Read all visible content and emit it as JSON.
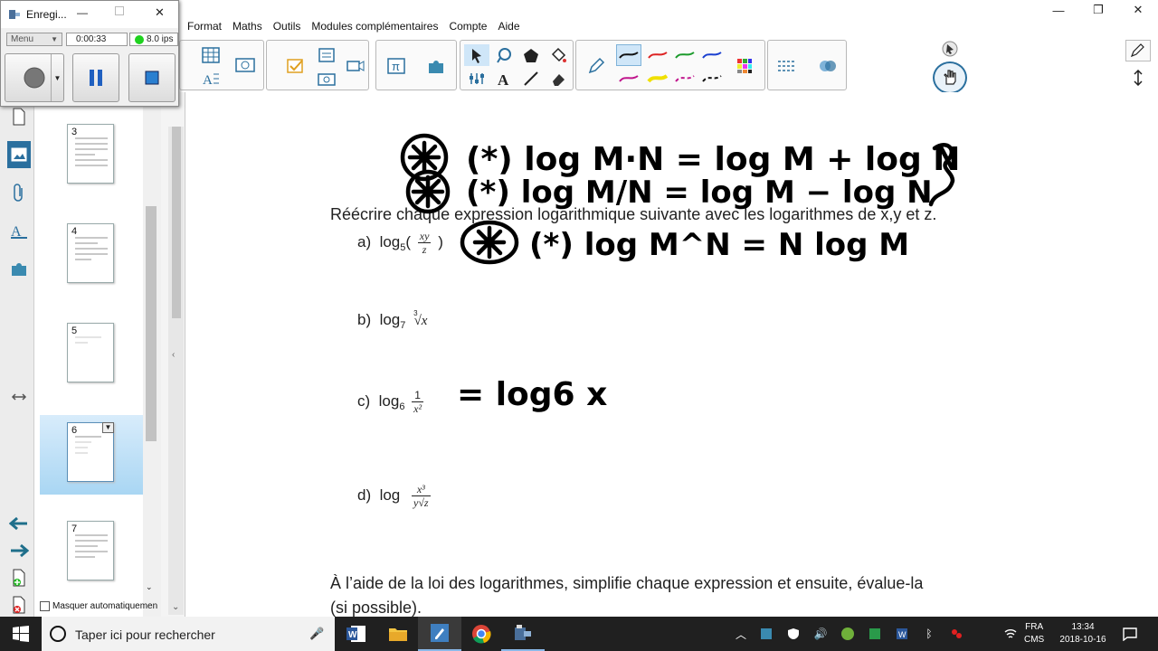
{
  "menu": {
    "items": [
      "Format",
      "Maths",
      "Outils",
      "Modules complémentaires",
      "Compte",
      "Aide"
    ]
  },
  "window_controls": {
    "minimize": "—",
    "restore": "❐",
    "close": "✕"
  },
  "recorder": {
    "title": "Enregi...",
    "menu_label": "Menu",
    "elapsed": "0:00:33",
    "fps": "8.0 ips",
    "minimize": "—",
    "close": "✕"
  },
  "sidebar": {
    "pages": [
      {
        "number": "3"
      },
      {
        "number": "4"
      },
      {
        "number": "5"
      },
      {
        "number": "6",
        "selected": true
      },
      {
        "number": "7"
      }
    ],
    "hide_label": "Masquer automatiquemen"
  },
  "page": {
    "instruction_1": "Réécrire chaque expression logarithmique suivante avec les logarithmes de x,y et z.",
    "items": [
      {
        "label": "a)",
        "expr": "log5(xy/z)"
      },
      {
        "label": "b)",
        "expr": "log7 ∛x"
      },
      {
        "label": "c)",
        "expr": "log6 1/x²"
      },
      {
        "label": "d)",
        "expr": "log x³/(y√z)"
      }
    ],
    "a": {
      "label": "a)",
      "log": "log",
      "base": "5",
      "num": "xy",
      "den": "z",
      "open": "(",
      "close": ")"
    },
    "b": {
      "label": "b)",
      "log": "log",
      "base": "7",
      "index": "3",
      "radicand": "√x"
    },
    "c": {
      "label": "c)",
      "log": "log",
      "base": "6",
      "num": "1",
      "den": "x²"
    },
    "d": {
      "label": "d)",
      "log": "log",
      "num": "x³",
      "den": "y√z"
    },
    "instruction_2_line1": "À l’aide de la loi des logarithmes, simplifie chaque expression et ensuite, évalue-la",
    "instruction_2_line2": "(si possible)."
  },
  "handwriting": {
    "rule_1": "(*) log M·N = log M + log N",
    "rule_2": "(*) log M/N = log M − log N",
    "rule_3": "(*) log M^N = N log M",
    "answer_c": "= log6 x"
  },
  "taskbar": {
    "search_placeholder": "Taper ici pour rechercher",
    "language_top": "FRA",
    "language_bottom": "CMS",
    "time": "13:34",
    "date": "2018-10-16"
  },
  "colors": {
    "accent_selection": "#a9d6f3",
    "fps_indicator": "#1fd21f",
    "ink": "#000000",
    "taskbar": "#202020"
  }
}
